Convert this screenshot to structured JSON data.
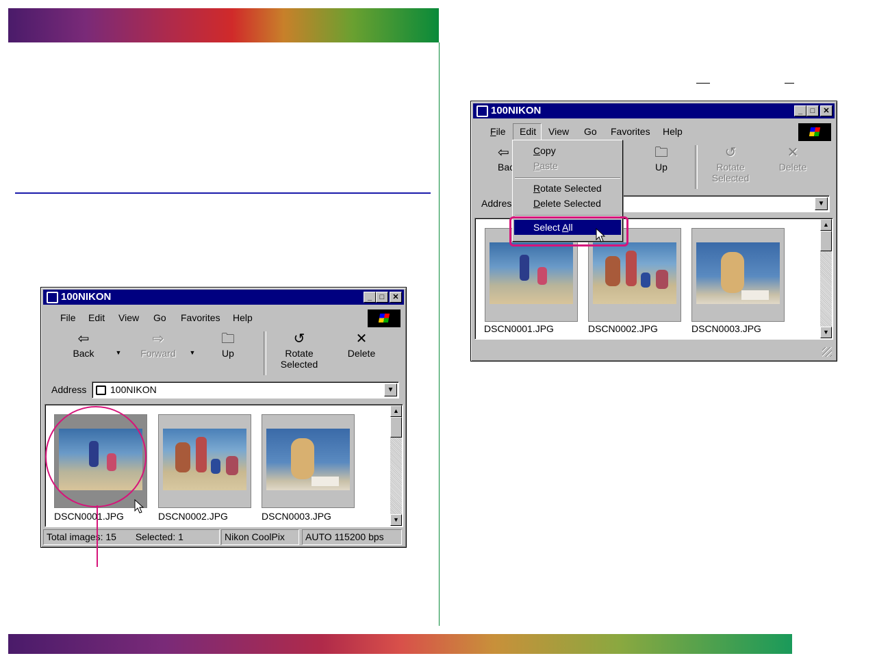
{
  "colors": {
    "accent_pink": "#d6147a",
    "title_blue": "#000080",
    "rule_blue": "#1a1aaa"
  },
  "left_window": {
    "title": "100NIKON",
    "menu": [
      "File",
      "Edit",
      "View",
      "Go",
      "Favorites",
      "Help"
    ],
    "toolbar": {
      "back": "Back",
      "forward": "Forward",
      "up": "Up",
      "rotate_line1": "Rotate",
      "rotate_line2": "Selected",
      "delete": "Delete"
    },
    "address": {
      "label": "Address",
      "value": "100NIKON"
    },
    "files": [
      {
        "name": "DSCN0001.JPG",
        "selected": true
      },
      {
        "name": "DSCN0002.JPG",
        "selected": false
      },
      {
        "name": "DSCN0003.JPG",
        "selected": false
      }
    ],
    "status": {
      "total_label": "Total images: 15",
      "selected_label": "Selected: 1",
      "camera": "Nikon CoolPix",
      "port": "AUTO  115200 bps"
    }
  },
  "right_window": {
    "title": "100NIKON",
    "menu": [
      "File",
      "Edit",
      "View",
      "Go",
      "Favorites",
      "Help"
    ],
    "toolbar": {
      "back_partial": "Bac",
      "up": "Up",
      "rotate_line1": "Rotate",
      "rotate_line2": "Selected",
      "delete": "Delete"
    },
    "address": {
      "label_partial": "Addres"
    },
    "edit_menu": {
      "copy": "Copy",
      "paste": "Paste",
      "rotate_selected": "Rotate Selected",
      "delete_selected": "Delete Selected",
      "select_all": "Select All"
    },
    "files": [
      "DSCN0001.JPG",
      "DSCN0002.JPG",
      "DSCN0003.JPG"
    ]
  },
  "icons": [
    "folder-camera-icon",
    "minimize-icon",
    "maximize-icon",
    "close-icon",
    "windows-logo-icon",
    "back-arrow-icon",
    "forward-arrow-icon",
    "up-folder-icon",
    "rotate-icon",
    "delete-x-icon",
    "dropdown-arrow-icon",
    "cursor-arrow-icon"
  ]
}
